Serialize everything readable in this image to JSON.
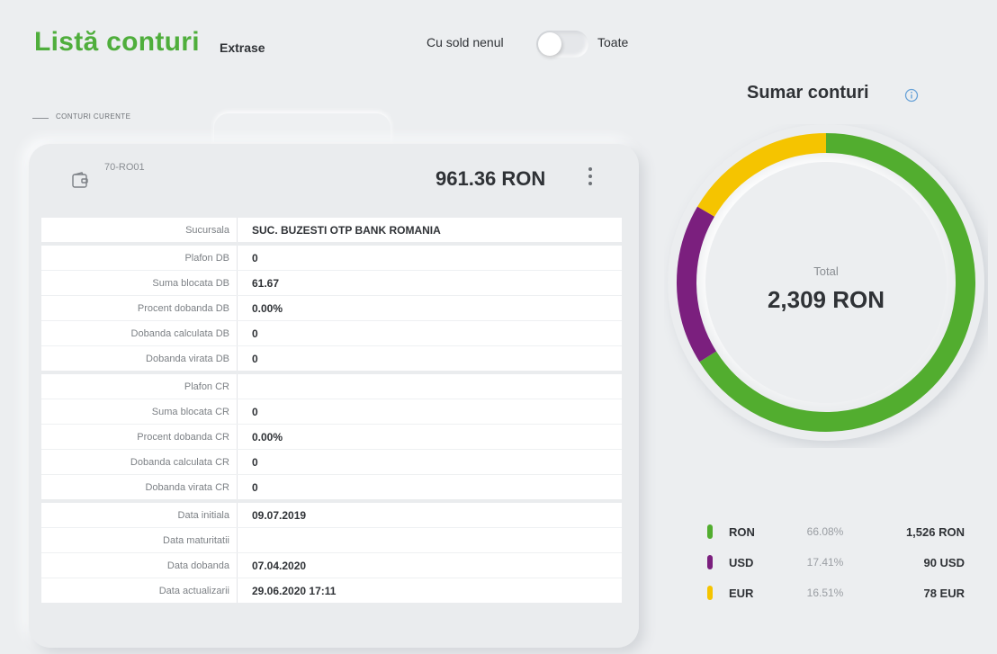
{
  "header": {
    "title": "Listă conturi",
    "extrase": "Extrase",
    "filter_left": "Cu sold nenul",
    "filter_right": "Toate"
  },
  "section": {
    "label": "CONTURI CURENTE"
  },
  "account": {
    "name": "70-RO01",
    "balance": "961.36 RON",
    "groups": [
      [
        {
          "label": "Sucursala",
          "value": "SUC. BUZESTI OTP BANK ROMANIA"
        }
      ],
      [
        {
          "label": "Plafon DB",
          "value": "0"
        },
        {
          "label": "Suma blocata DB",
          "value": "61.67"
        },
        {
          "label": "Procent dobanda DB",
          "value": "0.00%"
        },
        {
          "label": "Dobanda calculata DB",
          "value": "0"
        },
        {
          "label": "Dobanda virata DB",
          "value": "0"
        }
      ],
      [
        {
          "label": "Plafon CR",
          "value": ""
        },
        {
          "label": "Suma blocata CR",
          "value": "0"
        },
        {
          "label": "Procent dobanda CR",
          "value": "0.00%"
        },
        {
          "label": "Dobanda calculata CR",
          "value": "0"
        },
        {
          "label": "Dobanda virata CR",
          "value": "0"
        }
      ],
      [
        {
          "label": "Data initiala",
          "value": "09.07.2019"
        },
        {
          "label": "Data maturitatii",
          "value": ""
        },
        {
          "label": "Data dobanda",
          "value": "07.04.2020"
        },
        {
          "label": "Data actualizarii",
          "value": "29.06.2020 17:11"
        }
      ]
    ]
  },
  "summary": {
    "title": "Sumar conturi",
    "total_label": "Total",
    "total_value": "2,309 RON",
    "currencies": [
      {
        "currency": "RON",
        "percent": "66.08%",
        "amount": "1,526 RON",
        "share": 66.08,
        "color": "#52ad2f"
      },
      {
        "currency": "USD",
        "percent": "17.41%",
        "amount": "90 USD",
        "share": 17.41,
        "color": "#7b1f7e"
      },
      {
        "currency": "EUR",
        "percent": "16.51%",
        "amount": "78 EUR",
        "share": 16.51,
        "color": "#f5c400"
      }
    ]
  },
  "colors": {
    "brand_green": "#4fae3c"
  }
}
